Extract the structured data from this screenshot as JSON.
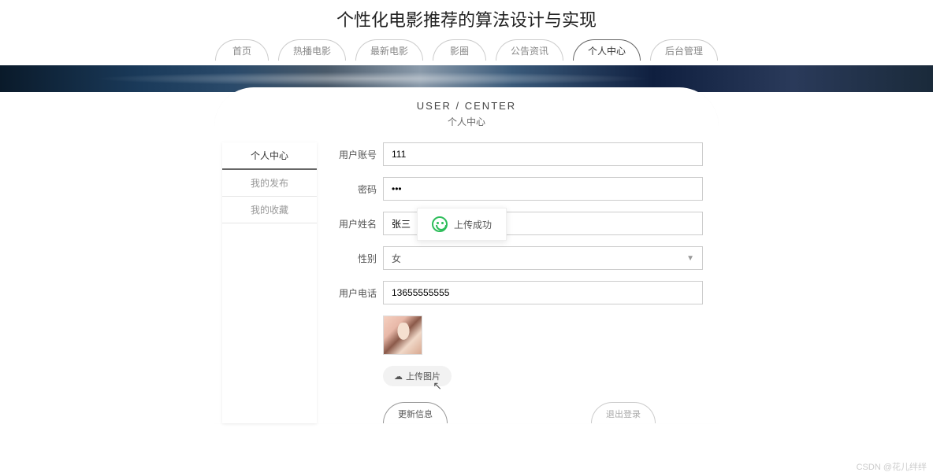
{
  "header": {
    "title": "个性化电影推荐的算法设计与实现"
  },
  "nav": {
    "items": [
      {
        "label": "首页"
      },
      {
        "label": "热播电影"
      },
      {
        "label": "最新电影"
      },
      {
        "label": "影圈"
      },
      {
        "label": "公告资讯"
      },
      {
        "label": "个人中心",
        "active": true
      },
      {
        "label": "后台管理"
      }
    ]
  },
  "section": {
    "title_en": "USER / CENTER",
    "title_cn": "个人中心"
  },
  "sidebar": {
    "items": [
      {
        "label": "个人中心",
        "active": true
      },
      {
        "label": "我的发布"
      },
      {
        "label": "我的收藏"
      }
    ]
  },
  "form": {
    "account": {
      "label": "用户账号",
      "value": "111"
    },
    "password": {
      "label": "密码",
      "value": "•••"
    },
    "name": {
      "label": "用户姓名",
      "value": "张三"
    },
    "gender": {
      "label": "性别",
      "value": "女"
    },
    "phone": {
      "label": "用户电话",
      "value": "13655555555"
    },
    "upload": {
      "label": "上传图片"
    }
  },
  "actions": {
    "update": "更新信息",
    "logout": "退出登录"
  },
  "toast": {
    "message": "上传成功"
  },
  "watermark": "CSDN @花儿绊绊"
}
